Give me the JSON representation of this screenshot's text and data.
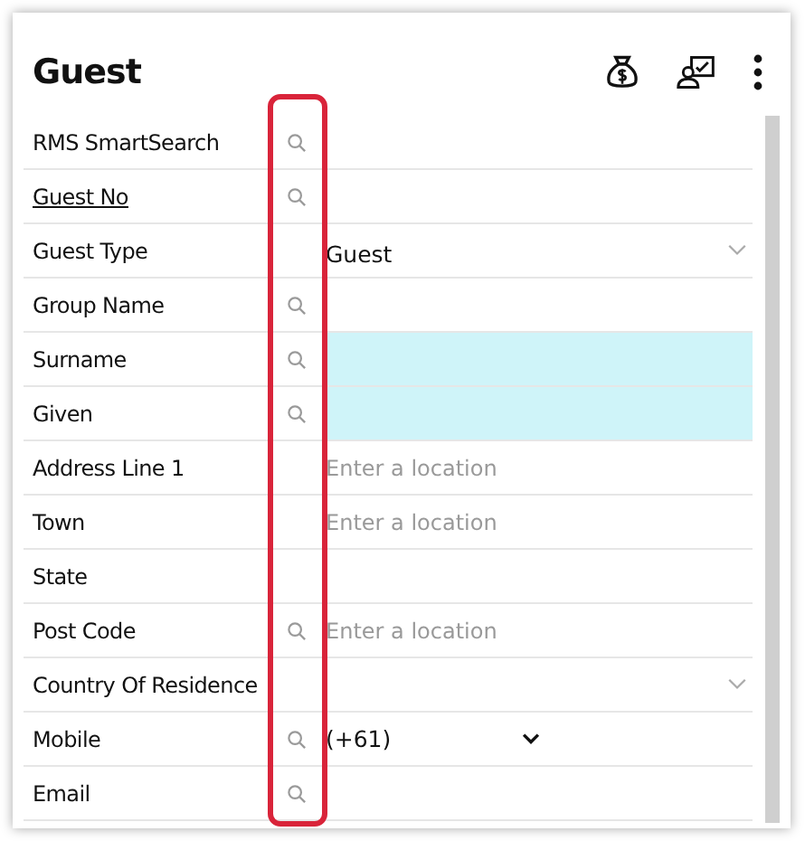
{
  "title": "Guest",
  "header_icons": [
    {
      "kind": "money-bag"
    },
    {
      "kind": "person-card"
    },
    {
      "kind": "more"
    }
  ],
  "fields": [
    {
      "label": "RMS SmartSearch",
      "kind": "text",
      "link": false,
      "searchable": true,
      "highlighted": false
    },
    {
      "label": "Guest No",
      "kind": "text",
      "link": true,
      "searchable": true,
      "highlighted": false
    },
    {
      "label": "Guest Type",
      "kind": "select",
      "link": false,
      "searchable": false,
      "highlighted": false,
      "value": "Guest"
    },
    {
      "label": "Group Name",
      "kind": "text",
      "link": false,
      "searchable": true,
      "highlighted": false
    },
    {
      "label": "Surname",
      "kind": "text",
      "link": false,
      "searchable": true,
      "highlighted": true
    },
    {
      "label": "Given",
      "kind": "text",
      "link": false,
      "searchable": true,
      "highlighted": true
    },
    {
      "label": "Address Line 1",
      "kind": "text",
      "link": false,
      "searchable": false,
      "highlighted": false,
      "placeholder": "Enter a location"
    },
    {
      "label": "Town",
      "kind": "text",
      "link": false,
      "searchable": false,
      "highlighted": false,
      "placeholder": "Enter a location"
    },
    {
      "label": "State",
      "kind": "text",
      "link": false,
      "searchable": false,
      "highlighted": false
    },
    {
      "label": "Post Code",
      "kind": "text",
      "link": false,
      "searchable": true,
      "highlighted": false,
      "placeholder": "Enter a location"
    },
    {
      "label": "Country Of Residence",
      "kind": "select",
      "link": false,
      "searchable": false,
      "highlighted": false
    },
    {
      "label": "Mobile",
      "kind": "phone",
      "link": false,
      "searchable": true,
      "highlighted": false,
      "value": "(+61)"
    },
    {
      "label": "Email",
      "kind": "text",
      "link": false,
      "searchable": true,
      "highlighted": false
    }
  ],
  "highlight_frame": true
}
